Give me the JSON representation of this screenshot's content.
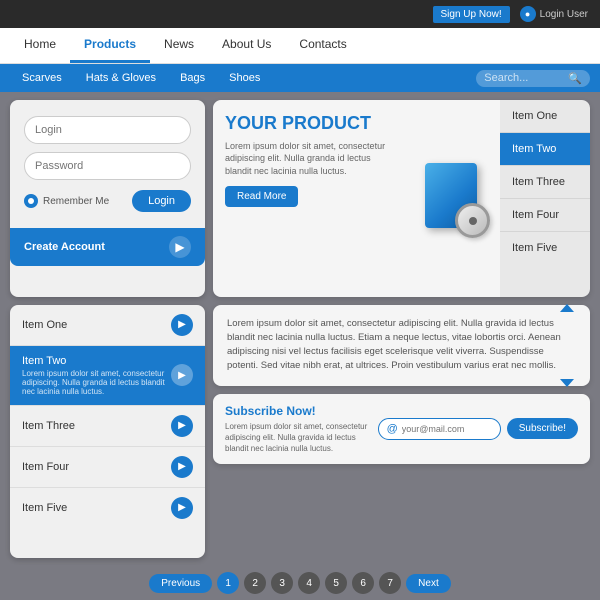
{
  "topbar": {
    "signup_label": "Sign Up Now!",
    "login_label": "Login User"
  },
  "navbar": {
    "items": [
      {
        "label": "Home",
        "active": false
      },
      {
        "label": "Products",
        "active": true
      },
      {
        "label": "News",
        "active": false
      },
      {
        "label": "About Us",
        "active": false
      },
      {
        "label": "Contacts",
        "active": false
      }
    ]
  },
  "subnav": {
    "items": [
      {
        "label": "Scarves"
      },
      {
        "label": "Hats & Gloves"
      },
      {
        "label": "Bags"
      },
      {
        "label": "Shoes"
      }
    ],
    "search_placeholder": "Search..."
  },
  "login": {
    "username_placeholder": "Login",
    "password_placeholder": "Password",
    "remember_label": "Remember Me",
    "login_btn": "Login",
    "create_label": "Create Account"
  },
  "product": {
    "title": "YOUR PRODUCT",
    "desc": "Lorem ipsum dolor sit amet, consectetur adipiscing elit. Nulla granda id lectus blandit nec lacinia nulla luctus.",
    "read_more": "Read More"
  },
  "item_list_right": [
    {
      "label": "Item One",
      "active": false
    },
    {
      "label": "Item Two",
      "active": true
    },
    {
      "label": "Item Three",
      "active": false
    },
    {
      "label": "Item Four",
      "active": false
    },
    {
      "label": "Item Five",
      "active": false
    }
  ],
  "bottom_left_items": [
    {
      "label": "Item One",
      "sub": "",
      "active": false
    },
    {
      "label": "Item Two",
      "sub": "Lorem ipsum dolor sit amet, consectetur adipiscing. Nulla granda id lectus blandit nec lacinia nulla luctus.",
      "active": true
    },
    {
      "label": "Item Three",
      "sub": "",
      "active": false
    },
    {
      "label": "Item Four",
      "sub": "",
      "active": false
    },
    {
      "label": "Item Five",
      "sub": "",
      "active": false
    }
  ],
  "text_content": "Lorem ipsum dolor sit amet, consectetur adipiscing elit. Nulla gravida id lectus blandit nec lacinia nulla luctus. Etiam a neque lectus, vitae lobortis orci. Aenean adipiscing nisi vel lectus facilisis eget scelerisque velit viverra. Suspendisse potenti. Sed vitae nibh erat, at ultrices. Proin vestibulum varius erat nec mollis.",
  "subscribe": {
    "title": "Subscribe Now!",
    "desc": "Lorem ipsum dolor sit amet, consectetur adipiscing elit. Nulla gravida id lectus blandit nec lacinia nulla luctus.",
    "email_placeholder": "your@mail.com",
    "btn_label": "Subscribe!"
  },
  "pagination": {
    "prev": "Previous",
    "next": "Next",
    "pages": [
      "1",
      "2",
      "3",
      "4",
      "5",
      "6",
      "7"
    ],
    "active_page": 1
  }
}
